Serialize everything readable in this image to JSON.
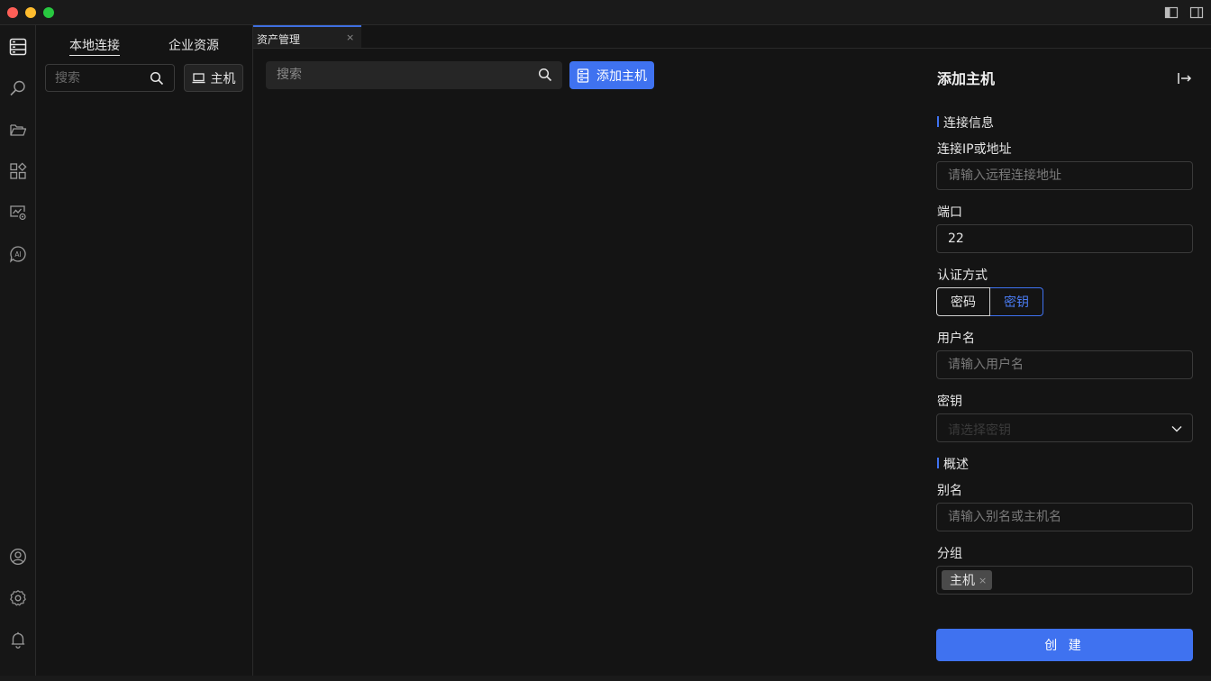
{
  "sidebar_tabs": {
    "local": "本地连接",
    "enterprise": "企业资源"
  },
  "left_panel": {
    "search_placeholder": "搜索",
    "host_button": "主机"
  },
  "doc_tab": {
    "label": "资产管理",
    "close": "×"
  },
  "main": {
    "search_placeholder": "搜索",
    "add_button": "添加主机"
  },
  "drawer": {
    "title": "添加主机",
    "section_connection": "连接信息",
    "ip_label": "连接IP或地址",
    "ip_placeholder": "请输入远程连接地址",
    "port_label": "端口",
    "port_value": "22",
    "auth_label": "认证方式",
    "auth_password": "密码",
    "auth_key": "密钥",
    "username_label": "用户名",
    "username_placeholder": "请输入用户名",
    "key_label": "密钥",
    "key_placeholder": "请选择密钥",
    "section_overview": "概述",
    "alias_label": "别名",
    "alias_placeholder": "请输入别名或主机名",
    "group_label": "分组",
    "group_tag": "主机",
    "tag_remove": "×",
    "create_button": "创 建"
  },
  "colors": {
    "accent": "#3f72f0",
    "background": "#141414"
  }
}
